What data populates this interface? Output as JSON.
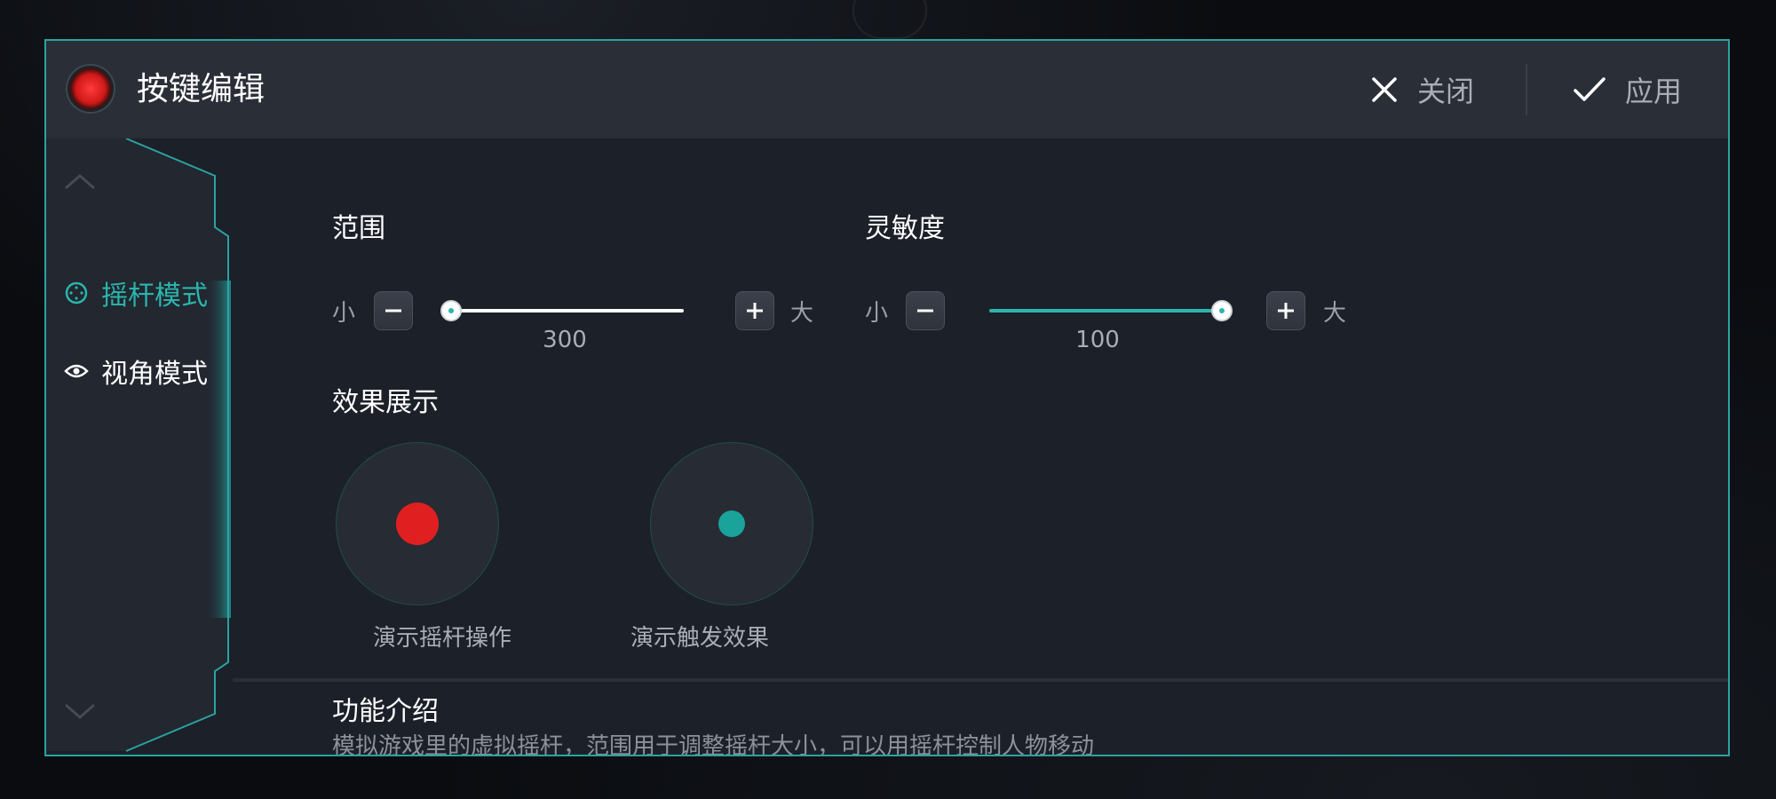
{
  "header": {
    "title": "按键编辑",
    "close_label": "关闭",
    "apply_label": "应用"
  },
  "sidebar": {
    "items": [
      {
        "label": "摇杆模式",
        "icon": "joystick-icon",
        "active": true
      },
      {
        "label": "视角模式",
        "icon": "eye-icon",
        "active": false
      }
    ]
  },
  "range": {
    "title": "范围",
    "min_label": "小",
    "max_label": "大",
    "value": "300",
    "position_fraction": 0.0
  },
  "sensitivity": {
    "title": "灵敏度",
    "min_label": "小",
    "max_label": "大",
    "value": "100",
    "position_fraction": 1.0
  },
  "effects": {
    "title": "效果展示",
    "demo_joystick_label": "演示摇杆操作",
    "demo_trigger_label": "演示触发效果"
  },
  "intro": {
    "title": "功能介绍",
    "text": "模拟游戏里的虚拟摇杆，范围用于调整摇杆大小，可以用摇杆控制人物移动"
  },
  "colors": {
    "accent": "#2bb5ad",
    "border": "#2aa3a0",
    "demo_red": "#e02020"
  }
}
